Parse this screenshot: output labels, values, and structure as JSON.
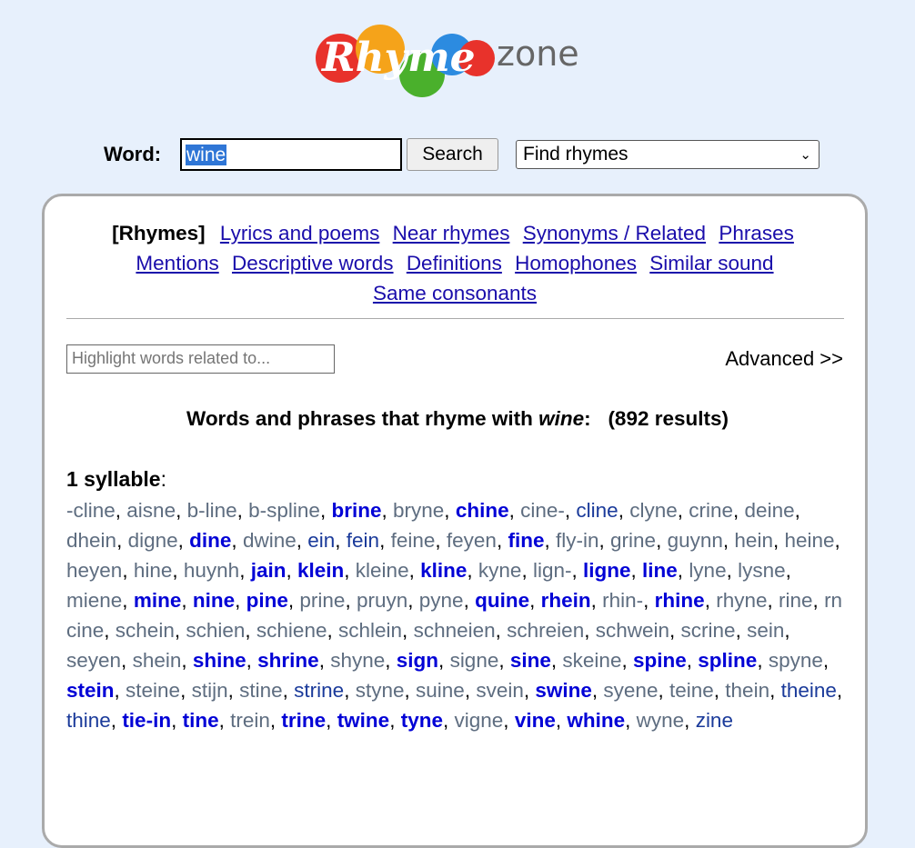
{
  "logo": {
    "part1": "Rhyme",
    "part2": "zone"
  },
  "search": {
    "label": "Word:",
    "value": "wine",
    "button": "Search",
    "mode": "Find rhymes"
  },
  "nav": {
    "current": "[Rhymes]",
    "links": [
      "Lyrics and poems",
      "Near rhymes",
      "Synonyms / Related",
      "Phrases",
      "Mentions",
      "Descriptive words",
      "Definitions",
      "Homophones",
      "Similar sound",
      "Same consonants"
    ]
  },
  "highlight_placeholder": "Highlight words related to...",
  "advanced": "Advanced >>",
  "heading": {
    "prefix": "Words and phrases that rhyme with ",
    "word": "wine",
    "suffix": ":",
    "count": "(892 results)"
  },
  "section": {
    "label": "1 syllable",
    "colon": ":"
  },
  "words": [
    {
      "t": "-cline",
      "k": "w"
    },
    {
      "t": "aisne",
      "k": "w"
    },
    {
      "t": "b-line",
      "k": "w"
    },
    {
      "t": "b-spline",
      "k": "w"
    },
    {
      "t": "brine",
      "k": "s"
    },
    {
      "t": "bryne",
      "k": "w"
    },
    {
      "t": "chine",
      "k": "s"
    },
    {
      "t": "cine-",
      "k": "w"
    },
    {
      "t": "cline",
      "k": "h"
    },
    {
      "t": "clyne",
      "k": "w"
    },
    {
      "t": "crine",
      "k": "w"
    },
    {
      "t": "deine",
      "k": "w"
    },
    {
      "t": "dhein",
      "k": "w"
    },
    {
      "t": "digne",
      "k": "w"
    },
    {
      "t": "dine",
      "k": "s"
    },
    {
      "t": "dwine",
      "k": "w"
    },
    {
      "t": "ein",
      "k": "h"
    },
    {
      "t": "fein",
      "k": "h"
    },
    {
      "t": "feine",
      "k": "w"
    },
    {
      "t": "feyen",
      "k": "w"
    },
    {
      "t": "fine",
      "k": "s"
    },
    {
      "t": "fly-in",
      "k": "w"
    },
    {
      "t": "grine",
      "k": "w"
    },
    {
      "t": "guynn",
      "k": "w"
    },
    {
      "t": "hein",
      "k": "w"
    },
    {
      "t": "heine",
      "k": "w"
    },
    {
      "t": "heyen",
      "k": "w"
    },
    {
      "t": "hine",
      "k": "w"
    },
    {
      "t": "huynh",
      "k": "w"
    },
    {
      "t": "jain",
      "k": "s"
    },
    {
      "t": "klein",
      "k": "s"
    },
    {
      "t": "kleine",
      "k": "w"
    },
    {
      "t": "kline",
      "k": "s"
    },
    {
      "t": "kyne",
      "k": "w"
    },
    {
      "t": "lign-",
      "k": "w"
    },
    {
      "t": "ligne",
      "k": "s"
    },
    {
      "t": "line",
      "k": "s"
    },
    {
      "t": "lyne",
      "k": "w"
    },
    {
      "t": "lysne",
      "k": "w"
    },
    {
      "t": "miene",
      "k": "w"
    },
    {
      "t": "mine",
      "k": "s"
    },
    {
      "t": "nine",
      "k": "s"
    },
    {
      "t": "pine",
      "k": "s"
    },
    {
      "t": "prine",
      "k": "w"
    },
    {
      "t": "pruyn",
      "k": "w"
    },
    {
      "t": "pyne",
      "k": "w"
    },
    {
      "t": "quine",
      "k": "s"
    },
    {
      "t": "rhein",
      "k": "s"
    },
    {
      "t": "rhin-",
      "k": "w"
    },
    {
      "t": "rhine",
      "k": "s"
    },
    {
      "t": "rhyne",
      "k": "w"
    },
    {
      "t": "rine",
      "k": "w"
    },
    {
      "t": "rn cine",
      "k": "w"
    },
    {
      "t": "schein",
      "k": "w"
    },
    {
      "t": "schien",
      "k": "w"
    },
    {
      "t": "schiene",
      "k": "w"
    },
    {
      "t": "schlein",
      "k": "w"
    },
    {
      "t": "schneien",
      "k": "w"
    },
    {
      "t": "schreien",
      "k": "w"
    },
    {
      "t": "schwein",
      "k": "w"
    },
    {
      "t": "scrine",
      "k": "w"
    },
    {
      "t": "sein",
      "k": "w"
    },
    {
      "t": "seyen",
      "k": "w"
    },
    {
      "t": "shein",
      "k": "w"
    },
    {
      "t": "shine",
      "k": "s"
    },
    {
      "t": "shrine",
      "k": "s"
    },
    {
      "t": "shyne",
      "k": "w"
    },
    {
      "t": "sign",
      "k": "s"
    },
    {
      "t": "signe",
      "k": "w"
    },
    {
      "t": "sine",
      "k": "s"
    },
    {
      "t": "skeine",
      "k": "w"
    },
    {
      "t": "spine",
      "k": "s"
    },
    {
      "t": "spline",
      "k": "s"
    },
    {
      "t": "spyne",
      "k": "w"
    },
    {
      "t": "stein",
      "k": "s"
    },
    {
      "t": "steine",
      "k": "w"
    },
    {
      "t": "stijn",
      "k": "w"
    },
    {
      "t": "stine",
      "k": "w"
    },
    {
      "t": "strine",
      "k": "h"
    },
    {
      "t": "styne",
      "k": "w"
    },
    {
      "t": "suine",
      "k": "w"
    },
    {
      "t": "svein",
      "k": "w"
    },
    {
      "t": "swine",
      "k": "s"
    },
    {
      "t": "syene",
      "k": "w"
    },
    {
      "t": "teine",
      "k": "w"
    },
    {
      "t": "thein",
      "k": "w"
    },
    {
      "t": "theine",
      "k": "h"
    },
    {
      "t": "thine",
      "k": "h"
    },
    {
      "t": "tie-in",
      "k": "s"
    },
    {
      "t": "tine",
      "k": "s"
    },
    {
      "t": "trein",
      "k": "w"
    },
    {
      "t": "trine",
      "k": "s"
    },
    {
      "t": "twine",
      "k": "s"
    },
    {
      "t": "tyne",
      "k": "s"
    },
    {
      "t": "vigne",
      "k": "w"
    },
    {
      "t": "vine",
      "k": "s"
    },
    {
      "t": "whine",
      "k": "s"
    },
    {
      "t": "wyne",
      "k": "w"
    },
    {
      "t": "zine",
      "k": "h"
    }
  ]
}
